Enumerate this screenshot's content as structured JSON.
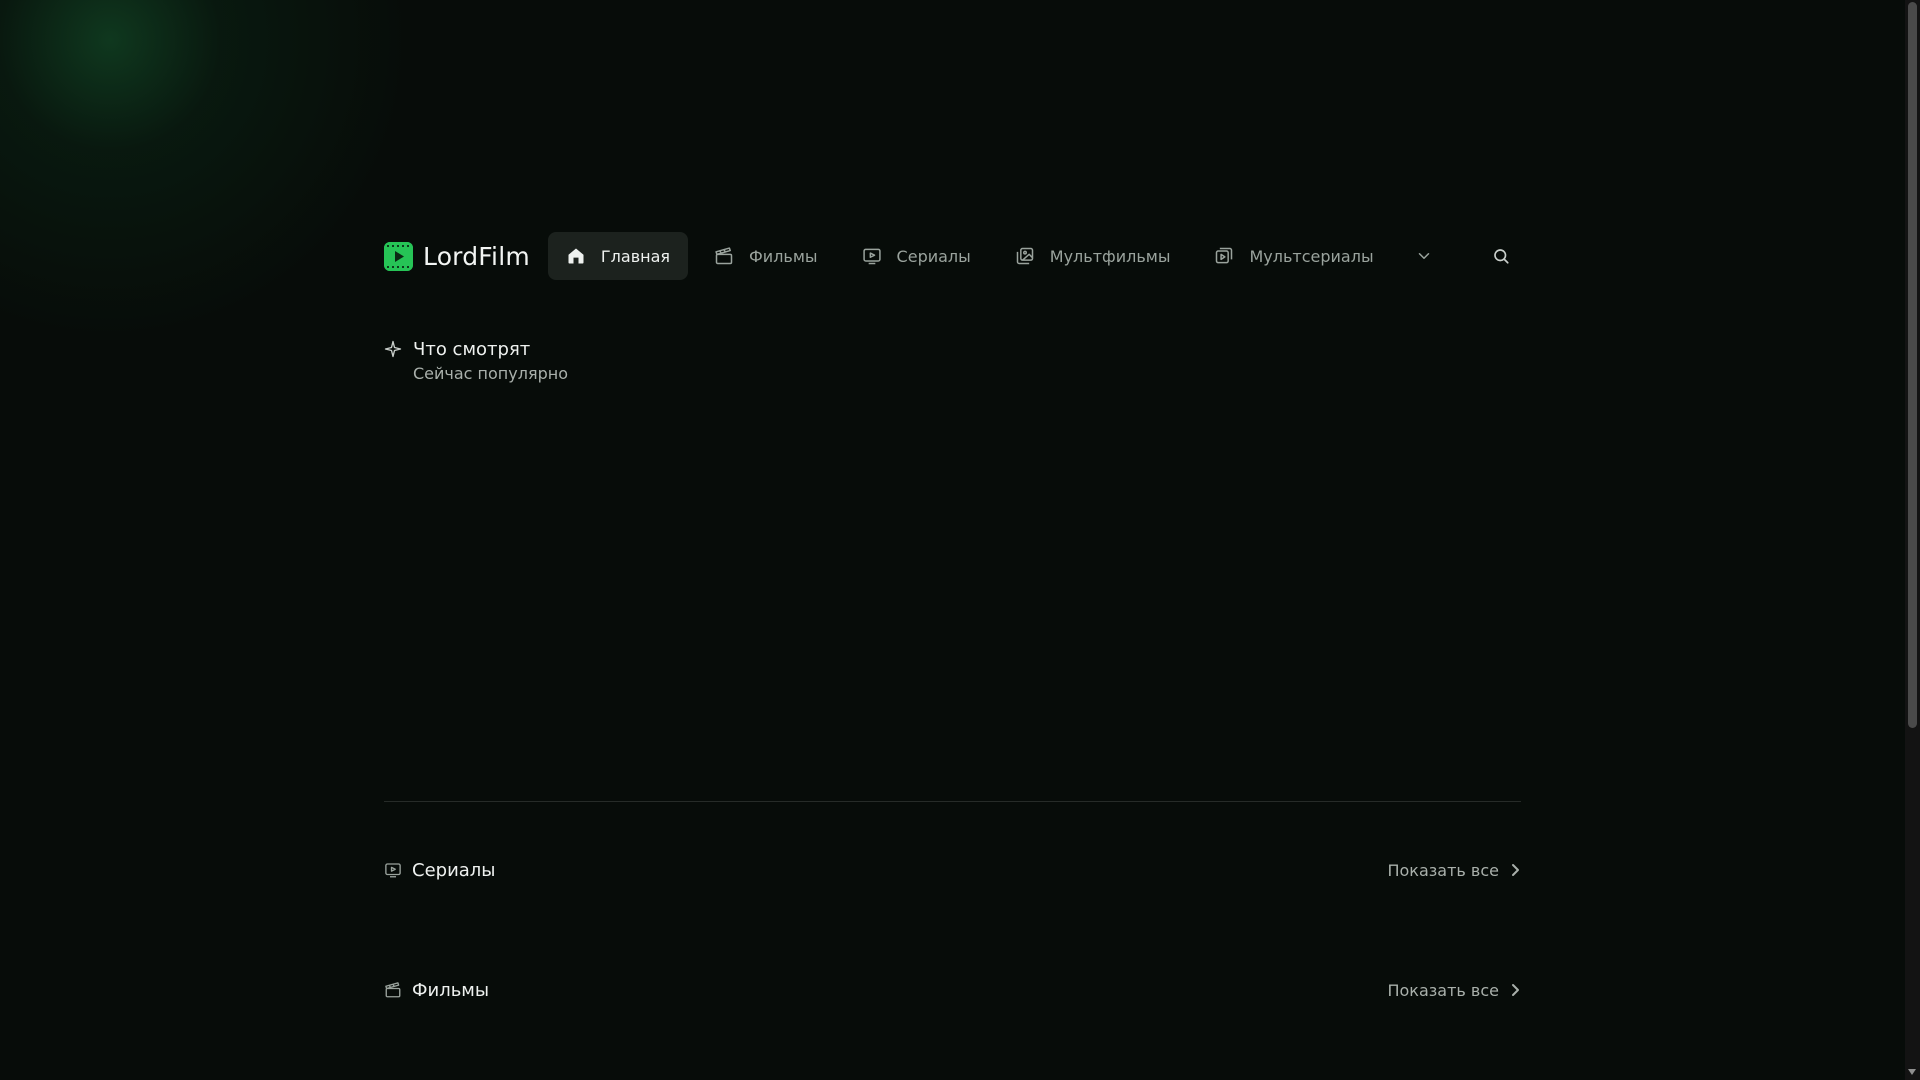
{
  "brand": {
    "name": "LordFilm",
    "accent": "#2fcf5e"
  },
  "nav": {
    "items": [
      {
        "label": "Главная",
        "icon": "home-icon",
        "active": true
      },
      {
        "label": "Фильмы",
        "icon": "clapperboard-icon",
        "active": false
      },
      {
        "label": "Сериалы",
        "icon": "tv-icon",
        "active": false
      },
      {
        "label": "Мультфильмы",
        "icon": "images-icon",
        "active": false
      },
      {
        "label": "Мультсериалы",
        "icon": "image-play-icon",
        "active": false
      }
    ],
    "more_icon": "chevron-down-icon",
    "search_icon": "search-icon"
  },
  "now_watching": {
    "title": "Что смотрят",
    "subtitle": "Сейчас популярно",
    "icon": "sparkle-icon"
  },
  "sections": [
    {
      "title": "Сериалы",
      "icon": "tv-icon",
      "show_all": "Показать все"
    },
    {
      "title": "Фильмы",
      "icon": "clapperboard-icon",
      "show_all": "Показать все"
    }
  ]
}
